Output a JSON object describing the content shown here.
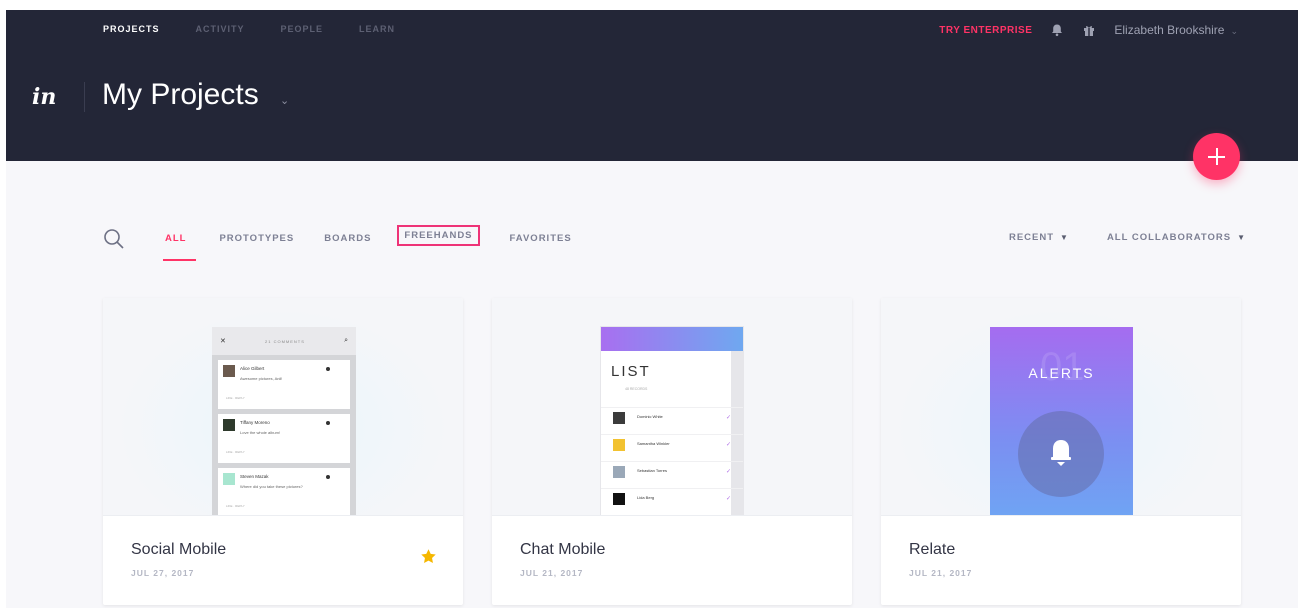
{
  "topnav": {
    "items": [
      "PROJECTS",
      "ACTIVITY",
      "PEOPLE",
      "LEARN"
    ],
    "try_enterprise": "TRY ENTERPRISE",
    "user_name": "Elizabeth Brookshire"
  },
  "header": {
    "logo": "in",
    "title": "My Projects"
  },
  "filters": {
    "tabs": [
      "ALL",
      "PROTOTYPES",
      "BOARDS",
      "FREEHANDS",
      "FAVORITES"
    ],
    "sort": "RECENT",
    "collaborators": "ALL COLLABORATORS"
  },
  "cards": [
    {
      "name": "Social Mobile",
      "date": "JUL 27, 2017",
      "favorite": true,
      "preview": {
        "header": "21 COMMENTS",
        "comments": [
          {
            "name": "Alice Gilbert",
            "text": "Awesome pictures, Anil!",
            "meta": "LIKE · REPLY"
          },
          {
            "name": "Tiffany Moreno",
            "text": "Love the whole album!",
            "meta": "LIKE · REPLY"
          },
          {
            "name": "Steven Mazak",
            "text": "Where did you take these pictures?",
            "meta": "LIKE · REPLY"
          }
        ]
      }
    },
    {
      "name": "Chat Mobile",
      "date": "JUL 21, 2017",
      "favorite": false,
      "preview": {
        "heading": "LIST",
        "subheading": "48 RECORDS",
        "rows": [
          "Dominic White",
          "Samantha Winkler",
          "Sebastian Torres",
          "Lida Berg"
        ]
      }
    },
    {
      "name": "Relate",
      "date": "JUL 21, 2017",
      "favorite": false,
      "preview": {
        "number": "01",
        "heading": "ALERTS"
      }
    }
  ],
  "colors": {
    "header_bg": "#232637",
    "accent": "#ff3366",
    "star": "#f5b700"
  }
}
